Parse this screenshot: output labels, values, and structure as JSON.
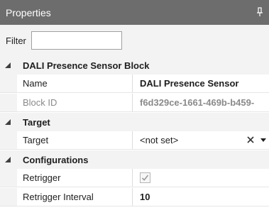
{
  "panel": {
    "title": "Properties"
  },
  "filter": {
    "label": "Filter",
    "value": "",
    "placeholder": ""
  },
  "categories": [
    {
      "label": "DALI Presence Sensor Block",
      "properties": [
        {
          "name": "Name",
          "value": "DALI Presence Sensor"
        },
        {
          "name": "Block ID",
          "value": "f6d329ce-1661-469b-b459-"
        }
      ]
    },
    {
      "label": "Target",
      "properties": [
        {
          "name": "Target",
          "value": "<not set>"
        }
      ]
    },
    {
      "label": "Configurations",
      "properties": [
        {
          "name": "Retrigger",
          "value": "checked"
        },
        {
          "name": "Retrigger Interval",
          "value": "10"
        }
      ]
    }
  ],
  "colors": {
    "titlebar": "#6d6d6d",
    "panel_bg": "#f3f3f3",
    "grid_bg": "#ffffff"
  },
  "icons": [
    "pin-icon",
    "collapse-triangle-icon",
    "clear-icon",
    "dropdown-arrow-icon",
    "checkbox-checked-icon"
  ]
}
